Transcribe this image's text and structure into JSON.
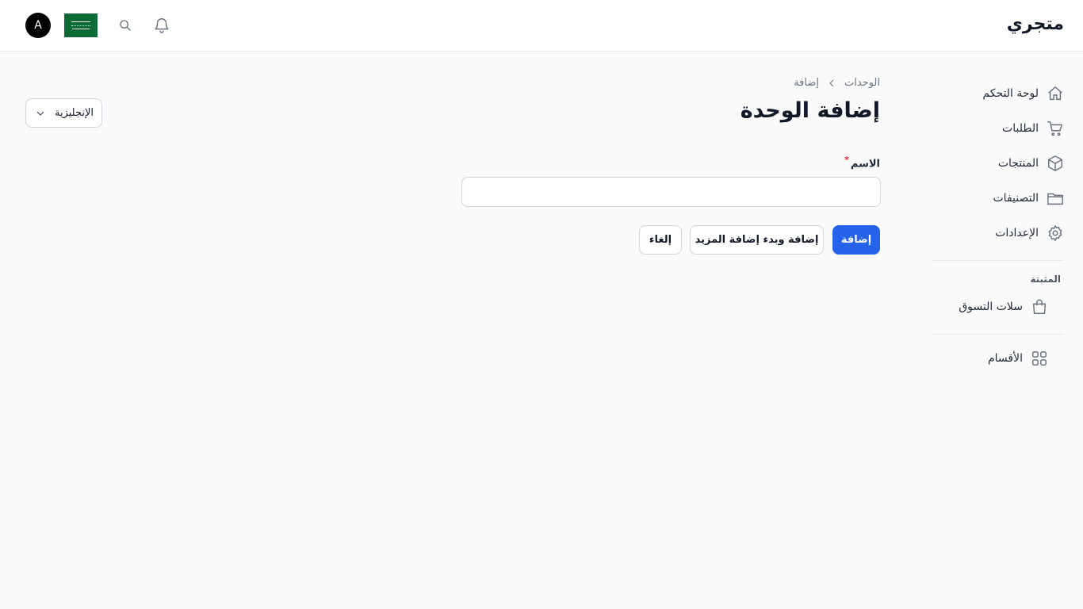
{
  "header": {
    "brand": "متجري",
    "avatar_initial": "A",
    "icons": [
      "bell-icon",
      "search-icon",
      "saudi-flag"
    ]
  },
  "sidebar": {
    "items": [
      {
        "label": "لوحة التحكم",
        "icon": "home-icon"
      },
      {
        "label": "الطلبات",
        "icon": "cart-icon"
      },
      {
        "label": "المنتجات",
        "icon": "box-icon"
      },
      {
        "label": "التصنيفات",
        "icon": "folder-icon"
      },
      {
        "label": "الإعدادات",
        "icon": "gear-icon"
      }
    ],
    "group_title": "المثبتة",
    "pinned": [
      {
        "label": "سلات التسوق",
        "icon": "shopping-bag-icon"
      }
    ],
    "sections": [
      {
        "label": "الأقسام",
        "icon": "grid-icon"
      }
    ]
  },
  "breadcrumb": {
    "parent": "الوحدات",
    "current": "إضافة"
  },
  "page_title": "إضافة الوحدة",
  "form": {
    "name_label": "الاسم",
    "required_mark": "*",
    "name_value": "",
    "name_placeholder": ""
  },
  "actions": {
    "add": "إضافة",
    "add_and_more": "إضافة وبدء إضافة المزيد",
    "cancel": "إلغاء"
  },
  "language_select": {
    "selected": "الإنجليزية"
  },
  "colors": {
    "primary": "#2563eb",
    "flag_green": "#0d6b35",
    "background": "#fafafa"
  }
}
